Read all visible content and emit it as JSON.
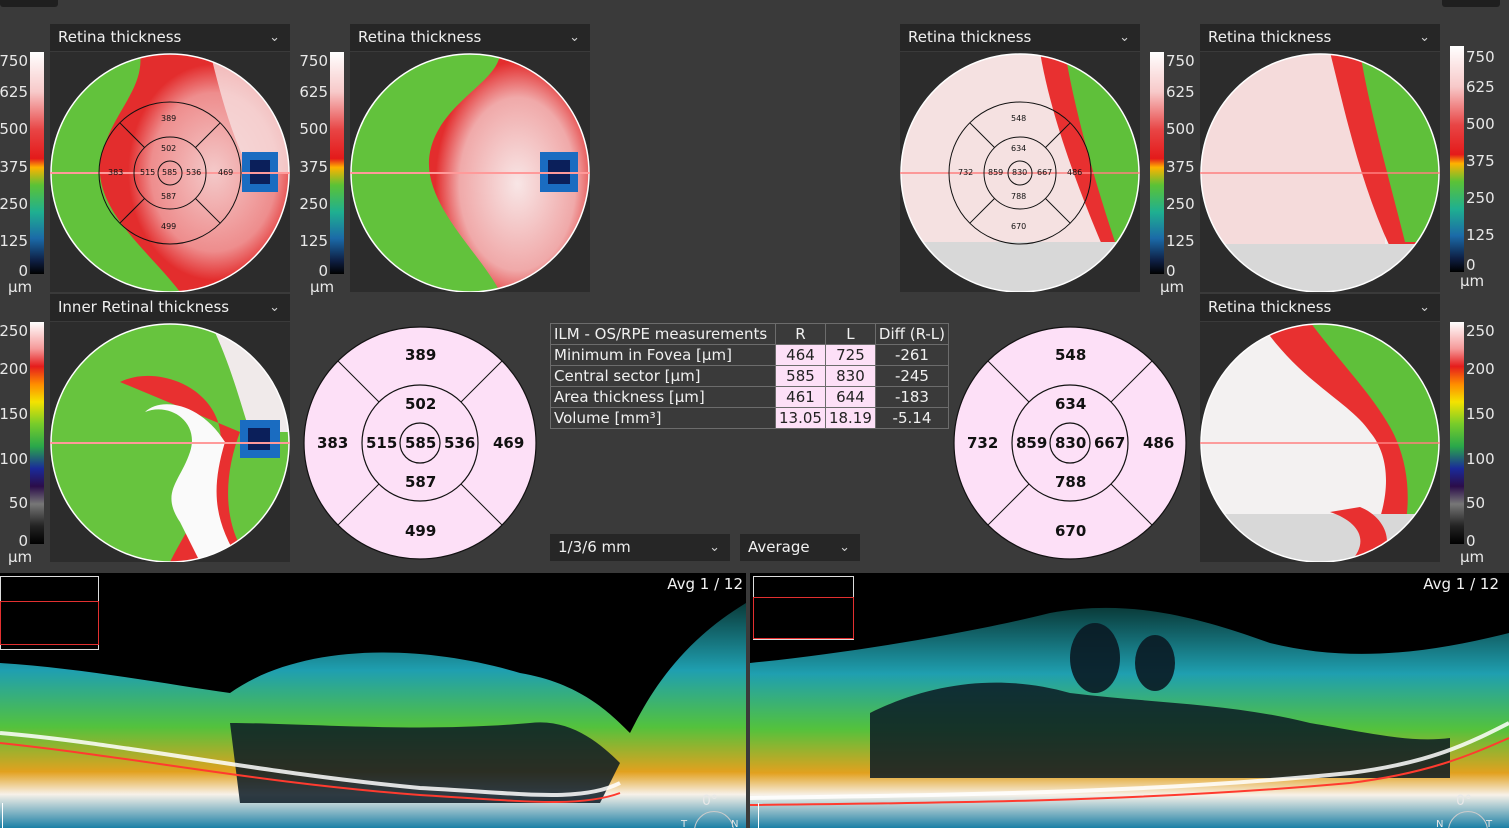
{
  "maps": {
    "top_right_eye_a": "Retina thickness",
    "top_right_eye_b": "Retina thickness",
    "top_left_eye_a": "Retina thickness",
    "top_left_eye_b": "Retina thickness",
    "bottom_right_eye": "Inner Retinal thickness",
    "bottom_left_eye": "Retina thickness"
  },
  "scale_750": {
    "ticks": [
      "750",
      "625",
      "500",
      "375",
      "250",
      "125",
      "0"
    ],
    "unit": "µm"
  },
  "scale_250": {
    "ticks": [
      "250",
      "200",
      "150",
      "100",
      "50",
      "0"
    ],
    "unit": "µm"
  },
  "grid_right": {
    "outer_top": "389",
    "inner_top": "502",
    "outer_left": "383",
    "inner_left": "515",
    "center": "585",
    "inner_right": "536",
    "outer_right": "469",
    "inner_bottom": "587",
    "outer_bottom": "499"
  },
  "grid_left": {
    "outer_top": "548",
    "inner_top": "634",
    "outer_left": "732",
    "inner_left": "859",
    "center": "830",
    "inner_right": "667",
    "outer_right": "486",
    "inner_bottom": "788",
    "outer_bottom": "670"
  },
  "measurements": {
    "header": [
      "ILM - OS/RPE measurements",
      "R",
      "L",
      "Diff (R-L)"
    ],
    "rows": [
      [
        "Minimum in Fovea [µm]",
        "464",
        "725",
        "-261"
      ],
      [
        "Central sector [µm]",
        "585",
        "830",
        "-245"
      ],
      [
        "Area thickness [µm]",
        "461",
        "644",
        "-183"
      ],
      [
        "Volume [mm³]",
        "13.05",
        "18.19",
        "-5.14"
      ]
    ]
  },
  "controls": {
    "grid_select": "1/3/6 mm",
    "mode_select": "Average"
  },
  "oct_right": {
    "avg": "Avg 1 / 12",
    "angle": "0°",
    "t": "T",
    "n": "N"
  },
  "oct_left": {
    "avg": "Avg 1 / 12",
    "angle": "0°",
    "n": "N",
    "t": "T"
  },
  "colors": {
    "background": "#3a3a3a",
    "panel": "#262626",
    "grid_fill": "#fde0f7"
  }
}
